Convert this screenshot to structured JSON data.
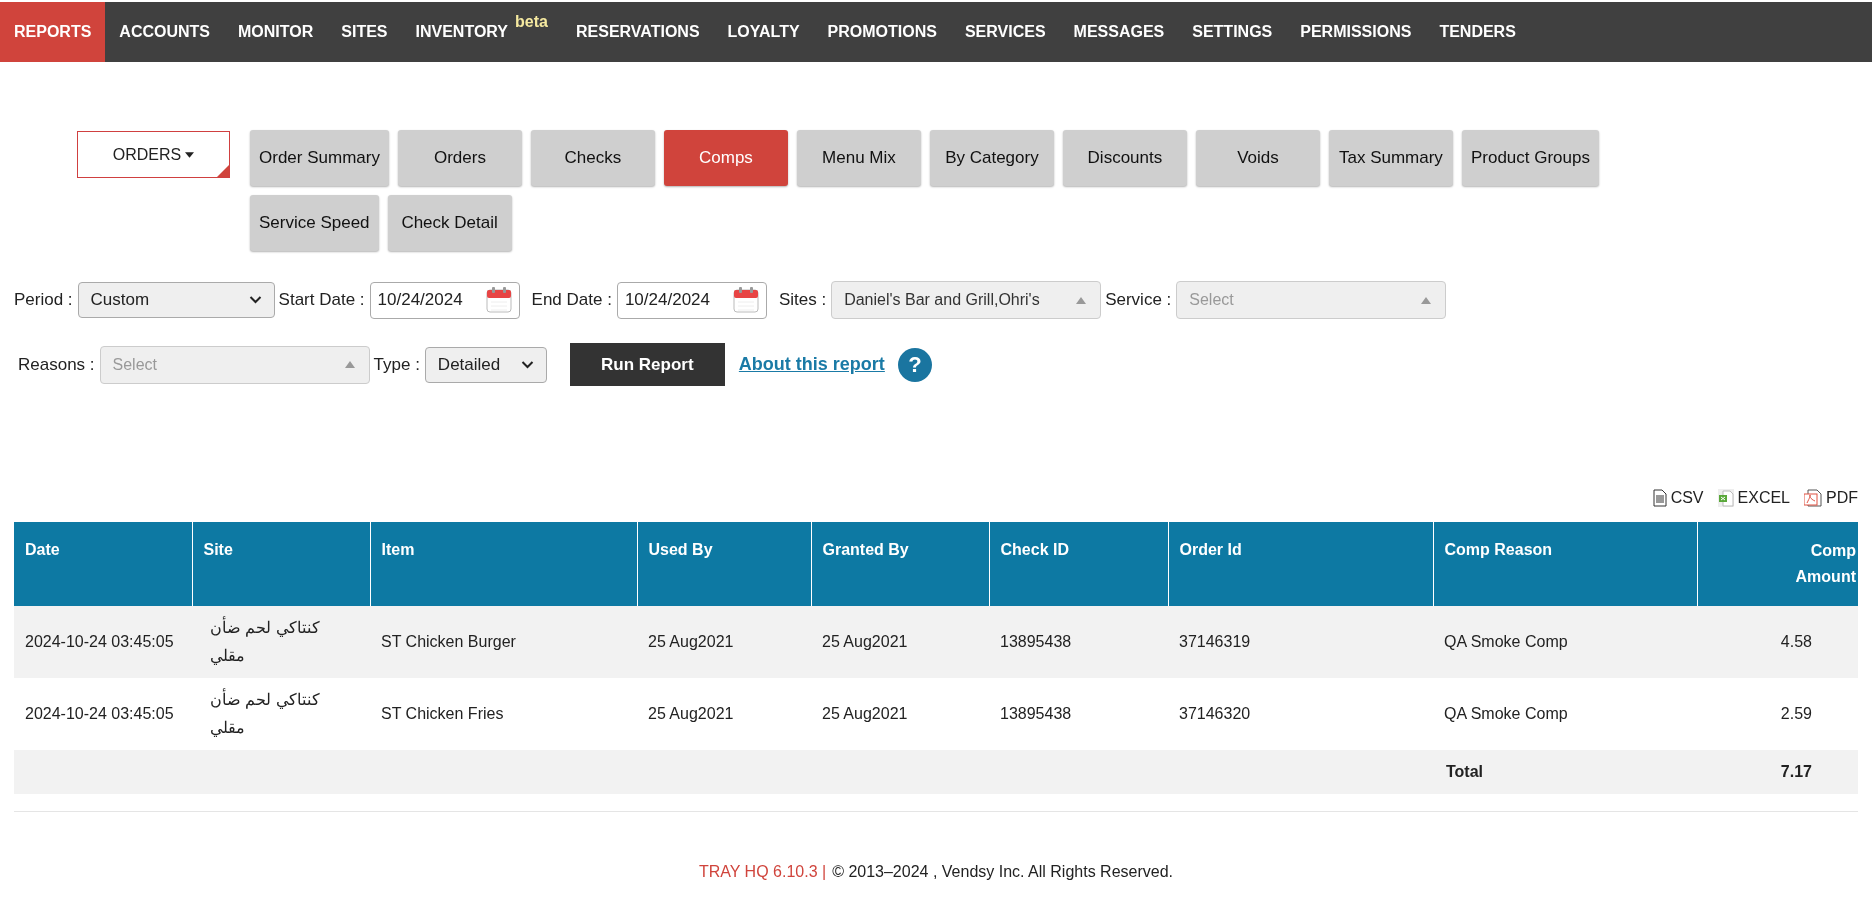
{
  "nav": [
    {
      "label": "REPORTS",
      "selected": true
    },
    {
      "label": "ACCOUNTS",
      "selected": false
    },
    {
      "label": "MONITOR",
      "selected": false
    },
    {
      "label": "SITES",
      "selected": false
    },
    {
      "label": "INVENTORY",
      "badge": "beta",
      "selected": false
    },
    {
      "label": "RESERVATIONS",
      "selected": false
    },
    {
      "label": "LOYALTY",
      "selected": false
    },
    {
      "label": "PROMOTIONS",
      "selected": false
    },
    {
      "label": "SERVICES",
      "selected": false
    },
    {
      "label": "MESSAGES",
      "selected": false
    },
    {
      "label": "SETTINGS",
      "selected": false
    },
    {
      "label": "PERMISSIONS",
      "selected": false
    },
    {
      "label": "TENDERS",
      "selected": false
    }
  ],
  "report_group": "ORDERS",
  "report_buttons": [
    {
      "label": "Order Summary",
      "selected": false
    },
    {
      "label": "Orders",
      "selected": false
    },
    {
      "label": "Checks",
      "selected": false
    },
    {
      "label": "Comps",
      "selected": true
    },
    {
      "label": "Menu Mix",
      "selected": false
    },
    {
      "label": "By Category",
      "selected": false
    },
    {
      "label": "Discounts",
      "selected": false
    },
    {
      "label": "Voids",
      "selected": false
    },
    {
      "label": "Tax Summary",
      "selected": false
    },
    {
      "label": "Product Groups",
      "selected": false
    },
    {
      "label": "Service Speed",
      "selected": false
    },
    {
      "label": "Check Detail",
      "selected": false
    }
  ],
  "filters": [
    {
      "kind": "select",
      "label": "Period :",
      "value": "Custom"
    },
    {
      "kind": "date",
      "label": "Start Date :",
      "value": "10/24/2024"
    },
    {
      "kind": "date",
      "label": "End Date :",
      "value": "10/24/2024"
    },
    {
      "kind": "multiselect",
      "label": "Sites :",
      "value": "Daniel's Bar and Grill,Ohri's"
    },
    {
      "kind": "multiselect",
      "label": "Service :",
      "placeholder": "Select"
    },
    {
      "kind": "break"
    },
    {
      "kind": "multiselect",
      "label": "Reasons :",
      "placeholder": "Select"
    },
    {
      "kind": "select",
      "label": "Type :",
      "value": "Detailed"
    }
  ],
  "run_button": "Run Report",
  "about_link": "About this report",
  "help_icon": "?",
  "exports": [
    "CSV",
    "EXCEL",
    "PDF"
  ],
  "table": {
    "columns": [
      "Date",
      "Site",
      "Item",
      "Used By",
      "Granted By",
      "Check ID",
      "Order Id",
      "Comp Reason",
      "Comp Amount"
    ],
    "rows": [
      [
        "2024-10-24 03:45:05",
        "كنتاكي لحم ضأن مقلي",
        "ST Chicken Burger",
        "25 Aug2021",
        "25 Aug2021",
        "13895438",
        "37146319",
        "QA Smoke Comp",
        "4.58"
      ],
      [
        "2024-10-24 03:45:05",
        "كنتاكي لحم ضأن مقلي",
        "ST Chicken Fries",
        "25 Aug2021",
        "25 Aug2021",
        "13895438",
        "37146320",
        "QA Smoke Comp",
        "2.59"
      ]
    ],
    "total_label": "Total",
    "total_value": "7.17"
  },
  "footer": {
    "version": "TRAY HQ 6.10.3 |",
    "copyright": "© 2013–2024 , Vendsy Inc. All Rights Reserved."
  }
}
